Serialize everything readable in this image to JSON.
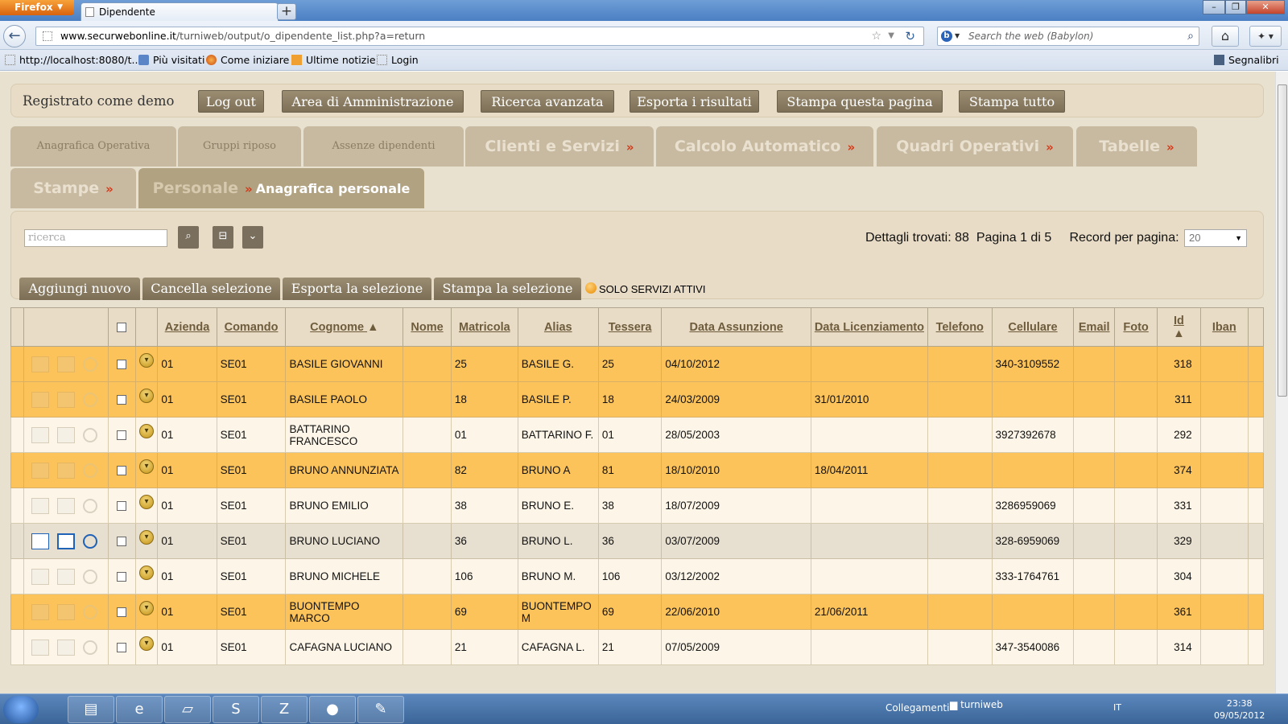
{
  "browser": {
    "app_button": "Firefox",
    "tab_title": "Dipendente",
    "new_tab": "+",
    "url_host": "www.securwebonline.it",
    "url_path": "/turniweb/output/o_dipendente_list.php?a=return",
    "search_placeholder": "Search the web (Babylon)",
    "bookmarks": [
      "http://localhost:8080/t...",
      "Più visitati",
      "Come iniziare",
      "Ultime notizie",
      "Login"
    ],
    "bookmarks_right": "Segnalibri"
  },
  "topbar": {
    "logged_as": "Registrato come demo",
    "buttons": [
      "Log out",
      "Area di Amministrazione",
      "Ricerca avanzata",
      "Esporta i risultati",
      "Stampa questa pagina",
      "Stampa tutto"
    ]
  },
  "menu": {
    "row1": [
      "Anagrafica Operativa",
      "Gruppi riposo",
      "Assenze dipendenti",
      "Clienti e Servizi",
      "Calcolo Automatico",
      "Quadri Operativi",
      "Tabelle"
    ],
    "row2": [
      "Stampe",
      "Personale",
      "Anagrafica personale"
    ],
    "raquo": "»"
  },
  "toolbar": {
    "search_placeholder": "ricerca",
    "details_found_label": "Dettagli trovati:",
    "details_found": "88",
    "page_info": "Pagina 1 di 5",
    "records_per_page_label": "Record per pagina:",
    "records_per_page": "20",
    "actions": [
      "Aggiungi nuovo",
      "Cancella selezione",
      "Esporta la selezione",
      "Stampa la selezione"
    ],
    "solo_servizi": "SOLO SERVIZI ATTIVI"
  },
  "table": {
    "columns": [
      "Azienda",
      "Comando",
      "Cognome",
      "Nome",
      "Matricola",
      "Alias",
      "Tessera",
      "Data Assunzione",
      "Data Licenziamento",
      "Telefono",
      "Cellulare",
      "Email",
      "Foto",
      "Id",
      "Iban"
    ],
    "rows": [
      {
        "azienda": "01",
        "comando": "SE01",
        "cognome": "BASILE GIOVANNI",
        "nome": "",
        "matricola": "25",
        "alias": "BASILE G.",
        "tessera": "25",
        "assunzione": "04/10/2012",
        "licenziamento": "",
        "telefono": "",
        "cellulare": "340-3109552",
        "email": "",
        "foto": "",
        "id": "318",
        "iban": "",
        "style": "orange"
      },
      {
        "azienda": "01",
        "comando": "SE01",
        "cognome": "BASILE PAOLO",
        "nome": "",
        "matricola": "18",
        "alias": "BASILE P.",
        "tessera": "18",
        "assunzione": "24/03/2009",
        "licenziamento": "31/01/2010",
        "telefono": "",
        "cellulare": "",
        "email": "",
        "foto": "",
        "id": "311",
        "iban": "",
        "style": "orange"
      },
      {
        "azienda": "01",
        "comando": "SE01",
        "cognome": "BATTARINO FRANCESCO",
        "nome": "",
        "matricola": "01",
        "alias": "BATTARINO F.",
        "tessera": "01",
        "assunzione": "28/05/2003",
        "licenziamento": "",
        "telefono": "",
        "cellulare": "3927392678",
        "email": "",
        "foto": "",
        "id": "292",
        "iban": "",
        "style": "light"
      },
      {
        "azienda": "01",
        "comando": "SE01",
        "cognome": "BRUNO ANNUNZIATA",
        "nome": "",
        "matricola": "82",
        "alias": "BRUNO A",
        "tessera": "81",
        "assunzione": "18/10/2010",
        "licenziamento": "18/04/2011",
        "telefono": "",
        "cellulare": "",
        "email": "",
        "foto": "",
        "id": "374",
        "iban": "",
        "style": "orange"
      },
      {
        "azienda": "01",
        "comando": "SE01",
        "cognome": "BRUNO EMILIO",
        "nome": "",
        "matricola": "38",
        "alias": "BRUNO E.",
        "tessera": "38",
        "assunzione": "18/07/2009",
        "licenziamento": "",
        "telefono": "",
        "cellulare": "3286959069",
        "email": "",
        "foto": "",
        "id": "331",
        "iban": "",
        "style": "light"
      },
      {
        "azienda": "01",
        "comando": "SE01",
        "cognome": "BRUNO LUCIANO",
        "nome": "",
        "matricola": "36",
        "alias": "BRUNO L.",
        "tessera": "36",
        "assunzione": "03/07/2009",
        "licenziamento": "",
        "telefono": "",
        "cellulare": "328-6959069",
        "email": "",
        "foto": "",
        "id": "329",
        "iban": "",
        "style": "hover"
      },
      {
        "azienda": "01",
        "comando": "SE01",
        "cognome": "BRUNO MICHELE",
        "nome": "",
        "matricola": "106",
        "alias": "BRUNO M.",
        "tessera": "106",
        "assunzione": "03/12/2002",
        "licenziamento": "",
        "telefono": "",
        "cellulare": "333-1764761",
        "email": "",
        "foto": "",
        "id": "304",
        "iban": "",
        "style": "light"
      },
      {
        "azienda": "01",
        "comando": "SE01",
        "cognome": "BUONTEMPO MARCO",
        "nome": "",
        "matricola": "69",
        "alias": "BUONTEMPO M",
        "tessera": "69",
        "assunzione": "22/06/2010",
        "licenziamento": "21/06/2011",
        "telefono": "",
        "cellulare": "",
        "email": "",
        "foto": "",
        "id": "361",
        "iban": "",
        "style": "orange"
      },
      {
        "azienda": "01",
        "comando": "SE01",
        "cognome": "CAFAGNA LUCIANO",
        "nome": "",
        "matricola": "21",
        "alias": "CAFAGNA L.",
        "tessera": "21",
        "assunzione": "07/05/2009",
        "licenziamento": "",
        "telefono": "",
        "cellulare": "347-3540086",
        "email": "",
        "foto": "",
        "id": "314",
        "iban": "",
        "style": "light"
      }
    ]
  },
  "taskbar": {
    "collegamenti": "Collegamenti",
    "folder": "turniweb",
    "lang": "IT",
    "time": "23:38",
    "date": "09/05/2012"
  }
}
